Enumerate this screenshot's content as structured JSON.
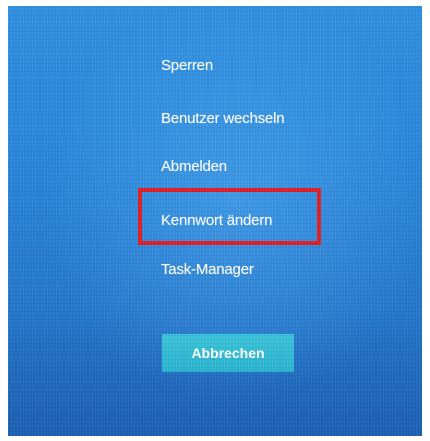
{
  "menu": {
    "items": [
      {
        "label": "Sperren"
      },
      {
        "label": "Benutzer wechseln"
      },
      {
        "label": "Abmelden"
      },
      {
        "label": "Kennwort ändern"
      },
      {
        "label": "Task-Manager"
      }
    ],
    "cancel_label": "Abbrechen"
  },
  "highlight": {
    "target": "Kennwort ändern",
    "color": "#e01e26"
  },
  "colors": {
    "background": "#2a86db",
    "button": "#2ab3cf",
    "text": "#ffffff"
  }
}
